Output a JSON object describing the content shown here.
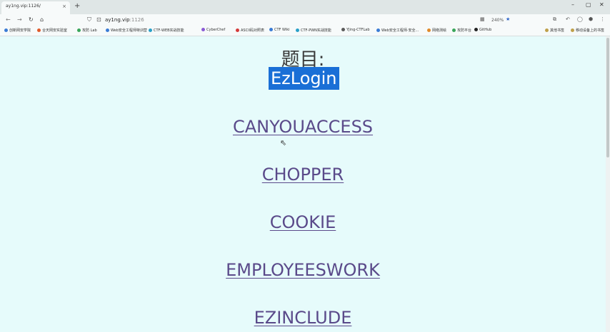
{
  "tab": {
    "title": "ay1ng.vip:1126/",
    "close": "×",
    "new": "+"
  },
  "window": {
    "minimize": "–",
    "maximize": "▢",
    "close": "✕"
  },
  "toolbar": {
    "url_host": "ay1ng.vip",
    "url_port": ":1126",
    "zoom": "240%"
  },
  "bookmarks": [
    "创新网安学院",
    "合天网安实验室",
    "攻防 Lab",
    "Web安全工程师特训营",
    "CTF-WEB实战技能",
    "CyberChef",
    "ASCII码对照表",
    "CTF Wiki",
    "CTF-PWN实战技能",
    "YJing-CTFLab",
    "Web安全工程师·安全...",
    "网络测绘",
    "攻防平台",
    "GitHub"
  ],
  "bookmarks_right": [
    "其他书签",
    "移动设备上的书签"
  ],
  "page": {
    "heading": "题目:",
    "selected_challenge": "EzLogin",
    "challenges": [
      "CANYOUACCESS",
      "CHOPPER",
      "COOKIE",
      "EMPLOYEESWORK",
      "EZINCLUDE"
    ]
  }
}
